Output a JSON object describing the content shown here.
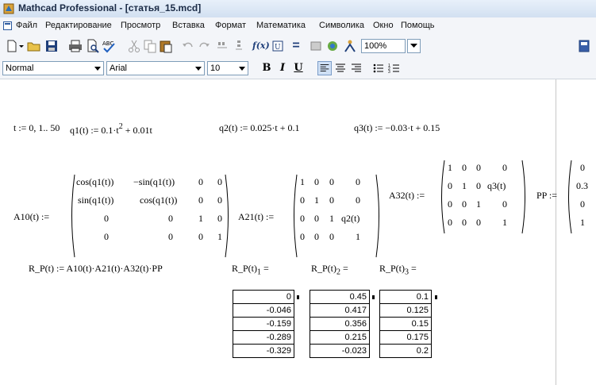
{
  "window": {
    "title": "Mathcad Professional - [статья_15.mcd]"
  },
  "menu": [
    "Файл",
    "Редактирование",
    "Просмотр",
    "Вставка",
    "Формат",
    "Математика",
    "Символика",
    "Окно",
    "Помощь"
  ],
  "toolbar": {
    "zoom": "100%",
    "fx_label": "f(x)",
    "equals_label": "="
  },
  "format_bar": {
    "style": "Normal",
    "font": "Arial",
    "size": "10",
    "bold": "B",
    "italic": "I",
    "underline": "U"
  },
  "worksheet": {
    "line1": {
      "t_def": "t := 0, 1.. 50",
      "q1_left": "q1(t) := 0.1·t",
      "q1_exp": "2",
      "q1_right": "+ 0.01t",
      "q2": "q2(t) := 0.025·t + 0.1",
      "q3": "q3(t) := −0.03·t + 0.15"
    },
    "A10": {
      "label": "A10(t) :=",
      "rows": [
        [
          "cos(q1(t))",
          "−sin(q1(t))",
          "0",
          "0"
        ],
        [
          "sin(q1(t))",
          "cos(q1(t))",
          "0",
          "0"
        ],
        [
          "0",
          "0",
          "1",
          "0"
        ],
        [
          "0",
          "0",
          "0",
          "1"
        ]
      ]
    },
    "A21": {
      "label": "A21(t) :=",
      "rows": [
        [
          "1",
          "0",
          "0",
          "0"
        ],
        [
          "0",
          "1",
          "0",
          "0"
        ],
        [
          "0",
          "0",
          "1",
          "q2(t)"
        ],
        [
          "0",
          "0",
          "0",
          "1"
        ]
      ]
    },
    "A32": {
      "label": "A32(t) :=",
      "rows": [
        [
          "1",
          "0",
          "0",
          "0"
        ],
        [
          "0",
          "1",
          "0",
          "q3(t)"
        ],
        [
          "0",
          "0",
          "1",
          "0"
        ],
        [
          "0",
          "0",
          "0",
          "1"
        ]
      ]
    },
    "PP": {
      "label": "PP :=",
      "values": [
        "0",
        "0.3",
        "0",
        "1"
      ]
    },
    "RP": {
      "def": "R_P(t) := A10(t)·A21(t)·A32(t)·PP",
      "eval1": "R_P(t)",
      "sub1": "1",
      "eval2": "R_P(t)",
      "sub2": "2",
      "eval3": "R_P(t)",
      "sub3": "3",
      "eq": "="
    },
    "results": {
      "col1": [
        "0",
        "-0.046",
        "-0.159",
        "-0.289",
        "-0.329"
      ],
      "col2": [
        "0.45",
        "0.417",
        "0.356",
        "0.215",
        "-0.023"
      ],
      "col3": [
        "0.1",
        "0.125",
        "0.15",
        "0.175",
        "0.2"
      ]
    }
  }
}
